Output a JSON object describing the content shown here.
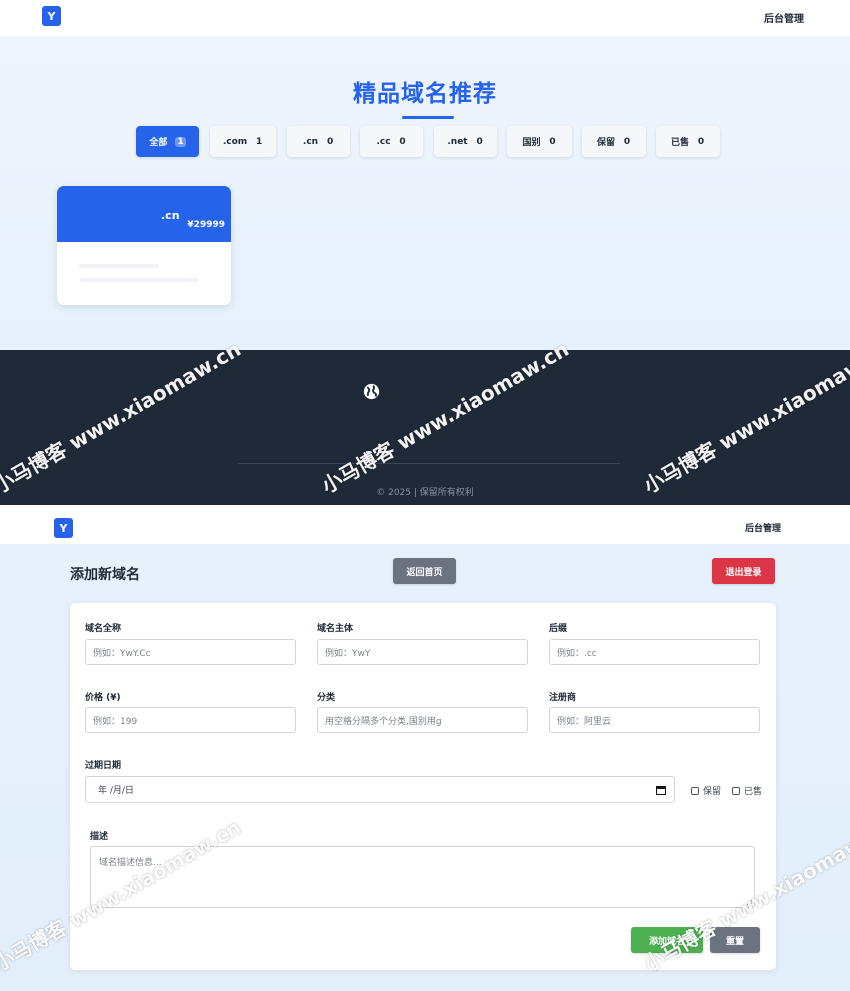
{
  "home": {
    "logo": "Y",
    "admin_link": "后台管理",
    "title": "精品域名推荐",
    "filters": [
      {
        "label": "全部",
        "count": "1"
      },
      {
        "label": ".com",
        "count": "1"
      },
      {
        "label": ".cn",
        "count": "0"
      },
      {
        "label": ".cc",
        "count": "0"
      },
      {
        "label": ".net",
        "count": "0"
      },
      {
        "label": "国别",
        "count": "0"
      },
      {
        "label": "保留",
        "count": "0"
      },
      {
        "label": "已售",
        "count": "0"
      }
    ],
    "active_filter": "全部",
    "card": {
      "suffix": ".cn",
      "price": "¥29999"
    },
    "footer": {
      "copyright": "© 2025 | 保留所有权利"
    }
  },
  "add_page": {
    "logo": "Y",
    "admin_link": "后台管理",
    "heading": "添加新域名",
    "back_button": "返回首页",
    "logout_button": "退出登录",
    "fields": {
      "full_name": {
        "label": "域名全称",
        "placeholder": "例如：YwY.Cc"
      },
      "subject": {
        "label": "域名主体",
        "placeholder": "例如：YwY"
      },
      "suffix": {
        "label": "后缀",
        "placeholder": "例如：.cc"
      },
      "price": {
        "label": "价格 (¥)",
        "placeholder": "例如：199"
      },
      "category": {
        "label": "分类",
        "placeholder": "用空格分隔多个分类,国别用g"
      },
      "registrar": {
        "label": "注册商",
        "placeholder": "例如：阿里云"
      },
      "expiry": {
        "label": "过期日期",
        "value": "年 /月/日"
      },
      "reserved": {
        "label": "保留"
      },
      "sold": {
        "label": "已售"
      },
      "description": {
        "label": "描述",
        "placeholder": "域名描述信息..."
      }
    },
    "submit_button": "添加域名",
    "reset_button": "重置"
  },
  "watermark": "小马博客 www.xiaomaw.cn",
  "colors": {
    "primary": "#2563eb",
    "footer_bg": "#1f2937",
    "danger": "#dc3545",
    "success": "#4caf50",
    "secondary": "#6b7280"
  }
}
